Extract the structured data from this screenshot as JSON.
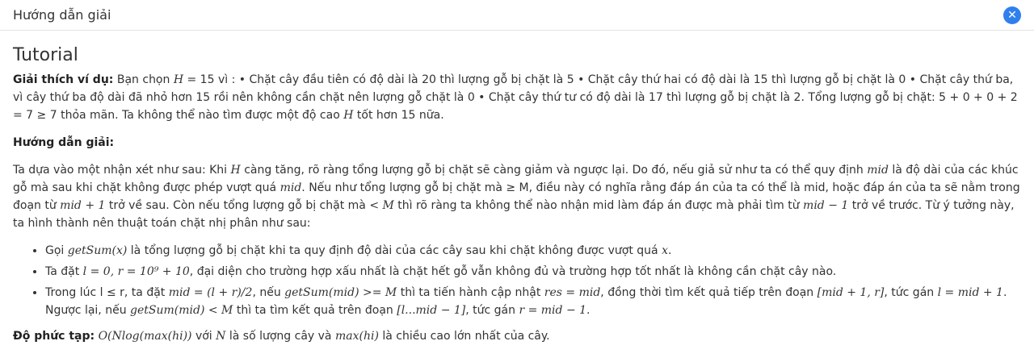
{
  "header": {
    "title": "Hướng dẫn giải",
    "close_glyph": "✕",
    "close_icon": "close-icon"
  },
  "tutorial": {
    "title": "Tutorial",
    "example_label": "Giải thích ví dụ:",
    "example_t1": "Bạn chọn",
    "example_m1": "H",
    "example_t2": "= 15 vì : • Chặt cây đầu tiên có độ dài là 20 thì lượng gỗ bị chặt là 5 • Chặt cây thứ hai có độ dài là 15 thì lượng gỗ bị chặt là 0 • Chặt cây thứ ba, vì cây thứ ba độ dài đã nhỏ hơn 15 rồi nên không cần chặt nên lượng gỗ chặt là 0 • Chặt cây thứ tư có độ dài là 17 thì lượng gỗ bị chặt là 2. Tổng lượng gỗ bị chặt: 5 + 0 + 0 + 2 = 7 ≥ 7 thỏa mãn. Ta không thể nào tìm được một độ cao",
    "example_m2": "H",
    "example_t3": "tốt hơn 15 nữa.",
    "guide_label": "Hướng dẫn giải:",
    "guide_t1": "Ta dựa vào một nhận xét như sau: Khi",
    "guide_m1": "H",
    "guide_t2": "càng tăng, rõ ràng tổng lượng gỗ bị chặt sẽ càng giảm và ngược lại. Do đó, nếu giả sử như ta có thể quy định",
    "guide_m2": "mid",
    "guide_t3": "là độ dài của các khúc gỗ mà sau khi chặt không được phép vượt quá",
    "guide_m3": "mid",
    "guide_t4": ". Nếu như tổng lượng gỗ bị chặt mà ≥ M, điều này có nghĩa rằng đáp án của ta có thể là mid, hoặc đáp án của ta sẽ nằm trong đoạn từ",
    "guide_m4": "mid + 1",
    "guide_t5": "trở về sau. Còn nếu tổng lượng gỗ bị chặt mà",
    "guide_m5": "< M",
    "guide_t6": "thì rõ ràng ta không thể nào nhận mid làm đáp án được mà phải tìm từ",
    "guide_m6": "mid − 1",
    "guide_t7": "trở về trước. Từ ý tưởng này, ta hình thành nên thuật toán chặt nhị phân như sau:",
    "b1_t1": "Gọi",
    "b1_m1": "getSum(x)",
    "b1_t2": "là tổng lượng gỗ bị chặt khi ta quy định độ dài của các cây sau khi chặt không được vượt quá",
    "b1_m2": "x",
    "b1_t3": ".",
    "b2_t1": "Ta đặt",
    "b2_m1": "l = 0, r = 10⁹ + 10",
    "b2_t2": ", đại diện cho trường hợp xấu nhất là chặt hết gỗ vẫn không đủ và trường hợp tốt nhất là không cần chặt cây nào.",
    "b3_t1": "Trong lúc l ≤ r, ta đặt",
    "b3_m1": "mid = (l + r)/2",
    "b3_t2": ", nếu",
    "b3_m2": "getSum(mid) >= M",
    "b3_t3": "thì ta tiến hành cập nhật",
    "b3_m3": "res = mid",
    "b3_t4": ", đồng thời tìm kết quả tiếp trên đoạn",
    "b3_m4": "[mid + 1, r]",
    "b3_t5": ", tức gán",
    "b3_m5": "l = mid + 1",
    "b3_t6": ". Ngược lại, nếu",
    "b3_m6": "getSum(mid) < M",
    "b3_t7": "thì ta tìm kết quả trên đoạn",
    "b3_m7": "[l...mid − 1]",
    "b3_t8": ", tức gán",
    "b3_m8": "r = mid − 1",
    "b3_t9": ".",
    "complexity_label": "Độ phức tạp:",
    "complexity_m1": "O(Nlog(max(hi))",
    "complexity_t1": "với",
    "complexity_m2": "N",
    "complexity_t2": "là số lượng cây và",
    "complexity_m3": "max(hi)",
    "complexity_t3": "là chiều cao lớn nhất của cây."
  }
}
